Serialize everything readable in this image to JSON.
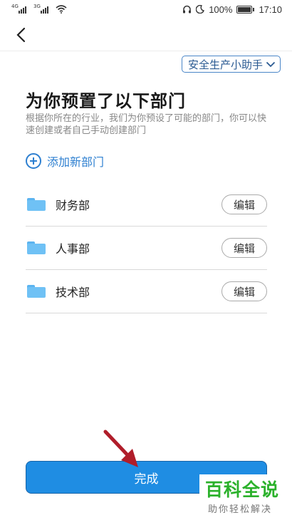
{
  "status_bar": {
    "signal1_label": "4G",
    "signal2_label": "3G",
    "battery_percent": "100%",
    "time": "17:10"
  },
  "header": {
    "assistant_label": "安全生产小助手"
  },
  "main": {
    "title": "为你预置了以下部门",
    "description": "根据你所在的行业，我们为你预设了可能的部门，你可以快速创建或者自己手动创建部门",
    "add_department_label": "添加新部门",
    "departments": [
      {
        "name": "财务部",
        "edit_label": "编辑"
      },
      {
        "name": "人事部",
        "edit_label": "编辑"
      },
      {
        "name": "技术部",
        "edit_label": "编辑"
      }
    ]
  },
  "footer": {
    "complete_label": "完成"
  },
  "watermark": {
    "title": "百科全说",
    "subtitle": "助你轻松解决"
  },
  "colors": {
    "primary": "#1f8de3",
    "link": "#2d7fd0",
    "folder": "#6fc1f5",
    "watermark_green": "#2bb12b",
    "arrow": "#b01d2a"
  },
  "icons": [
    "back-arrow-icon",
    "chevron-down-icon",
    "add-circle-icon",
    "folder-icon",
    "wifi-icon",
    "headset-icon",
    "moon-icon",
    "battery-icon"
  ]
}
